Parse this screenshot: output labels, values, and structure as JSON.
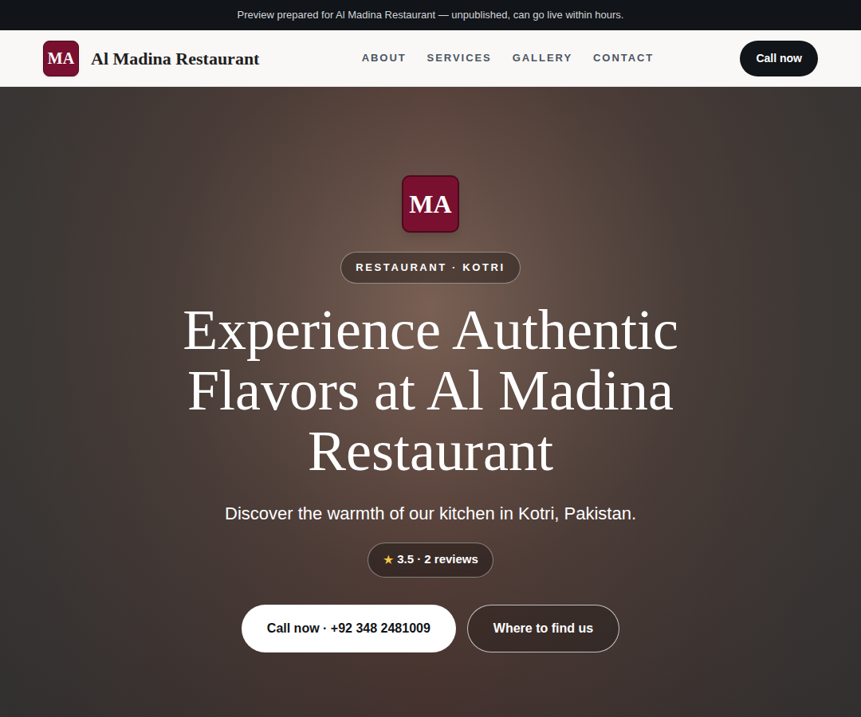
{
  "banner": "Preview prepared for Al Madina Restaurant — unpublished, can go live within hours.",
  "header": {
    "logo": "MA",
    "name": "Al Madina Restaurant",
    "nav": [
      {
        "label": "ABOUT"
      },
      {
        "label": "SERVICES"
      },
      {
        "label": "GALLERY"
      },
      {
        "label": "CONTACT"
      }
    ],
    "cta": "Call now"
  },
  "hero": {
    "logo": "MA",
    "badge": "RESTAURANT · KOTRI",
    "title": "Experience Authentic Flavors at Al Madina Restaurant",
    "subtitle": "Discover the warmth of our kitchen in Kotri, Pakistan.",
    "rating": {
      "star": "★",
      "text": "3.5 · 2 reviews"
    },
    "buttons": [
      "Call now · +92 348 2481009",
      "Where to find us"
    ]
  }
}
